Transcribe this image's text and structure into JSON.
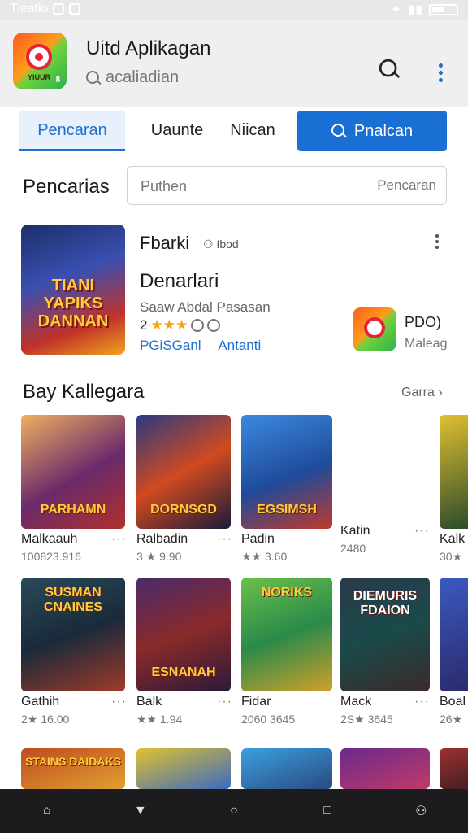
{
  "status": {
    "time": "Tieatlo"
  },
  "header": {
    "app_name": "Uitd Aplikagan",
    "subtitle": "acaliadian",
    "icon_tag": "YIUUR"
  },
  "tabs": [
    {
      "label": "Pencaran"
    },
    {
      "label": "Uaunte"
    },
    {
      "label": "Niican"
    },
    {
      "label": "Pnalcan"
    }
  ],
  "search": {
    "label": "Pencarias",
    "placeholder": "Puthen",
    "button": "Pencaran"
  },
  "featured": {
    "art_text": "TIANI YAPIKS DANNAN",
    "name": "Fbarki",
    "badge": "Ibod",
    "title": "Denarlari",
    "subtitle": "Saaw Abdal Pasasan",
    "rating": "2",
    "link1": "PGiSGanl",
    "link2": "Antanti",
    "side_label": "PDO)",
    "side_sub": "Maleag"
  },
  "section": {
    "title": "Bay Kallegara",
    "more": "Garra"
  },
  "games_row1": [
    {
      "art": "PARHAMN",
      "name": "Malkaauh",
      "meta": "100823.916"
    },
    {
      "art": "DORNSGD",
      "name": "Ralbadin",
      "meta": "3 ★ 9.90"
    },
    {
      "art": "EGSIMSH",
      "name": "Padin",
      "meta": "★★ 3.60"
    },
    {
      "art": "",
      "name": "Katin",
      "meta": "2480"
    },
    {
      "art": "",
      "name": "Kalk",
      "meta": "30★"
    }
  ],
  "games_row2": [
    {
      "art": "SUSMAN CNAINES",
      "name": "Gathih",
      "meta": "2★ 16.00"
    },
    {
      "art": "ESNANAH",
      "name": "Balk",
      "meta": "★★ 1.94"
    },
    {
      "art": "NORIKS",
      "name": "Fidar",
      "meta": "2060 3645"
    },
    {
      "art": "DIEMURIS FDAION",
      "name": "Mack",
      "meta": "2S★ 3645"
    },
    {
      "art": "",
      "name": "Boal",
      "meta": "26★"
    }
  ],
  "games_row3": [
    {
      "art": "STAINS DAIDAKS"
    },
    {
      "art": ""
    },
    {
      "art": ""
    },
    {
      "art": ""
    },
    {
      "art": ""
    }
  ]
}
